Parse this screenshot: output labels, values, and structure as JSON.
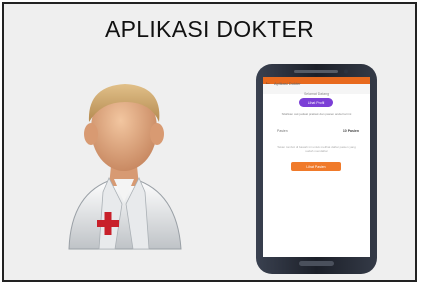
{
  "header": {
    "title": "APLIKASI DOKTER"
  },
  "phone_screen": {
    "app_bar_title": "Aplikasi Dokter",
    "profile_caption": "Selamat Datang",
    "profile_button": "Lihat Profil",
    "info_text": "Silahkan cek jadwal praktek dan pasien anda hari ini",
    "row_label": "Pasien",
    "row_value": "10 Pasien",
    "note_text": "Tekan tombol di bawah ini untuk melihat daftar pasien yang sudah mendaftar",
    "action_button": "Lihat Pasien"
  },
  "colors": {
    "frame_bg": "#efefef",
    "accent_orange": "#f07a2a",
    "accent_purple": "#7b3fd6",
    "phone_body": "#1f2430"
  },
  "icons": {
    "doctor": "doctor-avatar-icon",
    "red_cross": "red-cross-icon",
    "back": "arrow-back-icon"
  }
}
